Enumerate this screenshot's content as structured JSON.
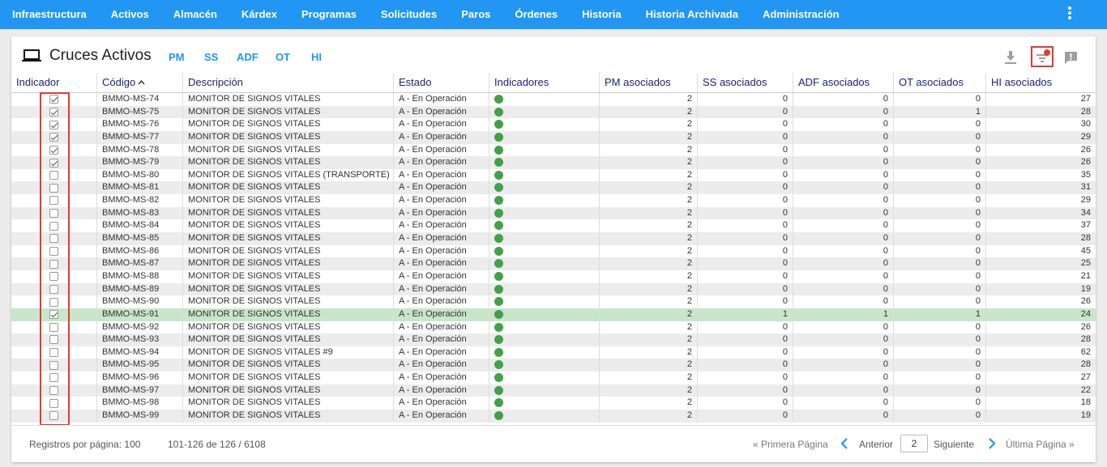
{
  "nav": {
    "items": [
      "Infraestructura",
      "Activos",
      "Almacén",
      "Kárdex",
      "Programas",
      "Solicitudes",
      "Paros",
      "Órdenes",
      "Historia",
      "Historia Archivada",
      "Administración"
    ],
    "menu_icon": "kebab-menu-icon"
  },
  "header": {
    "icon": "laptop-icon",
    "title": "Cruces Activos",
    "links": [
      "PM",
      "SS",
      "ADF",
      "OT",
      "HI"
    ],
    "tools": {
      "download": "download-icon",
      "filter": "filter-icon",
      "feedback": "feedback-icon"
    },
    "filter_active_color": "#e53935"
  },
  "table": {
    "columns": [
      "Indicador",
      "Código",
      "Descripción",
      "Estado",
      "Indicadores",
      "PM asociados",
      "SS asociados",
      "ADF asociados",
      "OT asociados",
      "HI asociados"
    ],
    "sort_indicator": "^",
    "sorted_column": "Código",
    "indicator_color": "#43a047",
    "highlight_color": "#c8e6c9",
    "rows": [
      {
        "checked": true,
        "code": "BMMO-MS-74",
        "desc": "MONITOR DE SIGNOS VITALES",
        "state": "A - En Operación",
        "pm": "2",
        "ss": "0",
        "adf": "0",
        "ot": "0",
        "hi": "27"
      },
      {
        "checked": true,
        "code": "BMMO-MS-75",
        "desc": "MONITOR DE SIGNOS VITALES",
        "state": "A - En Operación",
        "pm": "2",
        "ss": "0",
        "adf": "0",
        "ot": "1",
        "hi": "28"
      },
      {
        "checked": true,
        "code": "BMMO-MS-76",
        "desc": "MONITOR DE SIGNOS VITALES",
        "state": "A - En Operación",
        "pm": "2",
        "ss": "0",
        "adf": "0",
        "ot": "0",
        "hi": "30"
      },
      {
        "checked": true,
        "code": "BMMO-MS-77",
        "desc": "MONITOR DE SIGNOS VITALES",
        "state": "A - En Operación",
        "pm": "2",
        "ss": "0",
        "adf": "0",
        "ot": "0",
        "hi": "29"
      },
      {
        "checked": true,
        "code": "BMMO-MS-78",
        "desc": "MONITOR DE SIGNOS VITALES",
        "state": "A - En Operación",
        "pm": "2",
        "ss": "0",
        "adf": "0",
        "ot": "0",
        "hi": "26"
      },
      {
        "checked": true,
        "code": "BMMO-MS-79",
        "desc": "MONITOR DE SIGNOS VITALES",
        "state": "A - En Operación",
        "pm": "2",
        "ss": "0",
        "adf": "0",
        "ot": "0",
        "hi": "26"
      },
      {
        "checked": false,
        "code": "BMMO-MS-80",
        "desc": "MONITOR DE SIGNOS VITALES (TRANSPORTE)",
        "state": "A - En Operación",
        "pm": "2",
        "ss": "0",
        "adf": "0",
        "ot": "0",
        "hi": "35"
      },
      {
        "checked": false,
        "code": "BMMO-MS-81",
        "desc": "MONITOR DE SIGNOS VITALES",
        "state": "A - En Operación",
        "pm": "2",
        "ss": "0",
        "adf": "0",
        "ot": "0",
        "hi": "31"
      },
      {
        "checked": false,
        "code": "BMMO-MS-82",
        "desc": "MONITOR DE SIGNOS VITALES",
        "state": "A - En Operación",
        "pm": "2",
        "ss": "0",
        "adf": "0",
        "ot": "0",
        "hi": "29"
      },
      {
        "checked": false,
        "code": "BMMO-MS-83",
        "desc": "MONITOR DE SIGNOS VITALES",
        "state": "A - En Operación",
        "pm": "2",
        "ss": "0",
        "adf": "0",
        "ot": "0",
        "hi": "34"
      },
      {
        "checked": false,
        "code": "BMMO-MS-84",
        "desc": "MONITOR DE SIGNOS VITALES",
        "state": "A - En Operación",
        "pm": "2",
        "ss": "0",
        "adf": "0",
        "ot": "0",
        "hi": "37"
      },
      {
        "checked": false,
        "code": "BMMO-MS-85",
        "desc": "MONITOR DE SIGNOS VITALES",
        "state": "A - En Operación",
        "pm": "2",
        "ss": "0",
        "adf": "0",
        "ot": "0",
        "hi": "28"
      },
      {
        "checked": false,
        "code": "BMMO-MS-86",
        "desc": "MONITOR DE SIGNOS VITALES",
        "state": "A - En Operación",
        "pm": "2",
        "ss": "0",
        "adf": "0",
        "ot": "0",
        "hi": "45"
      },
      {
        "checked": false,
        "code": "BMMO-MS-87",
        "desc": "MONITOR DE SIGNOS VITALES",
        "state": "A - En Operación",
        "pm": "2",
        "ss": "0",
        "adf": "0",
        "ot": "0",
        "hi": "25"
      },
      {
        "checked": false,
        "code": "BMMO-MS-88",
        "desc": "MONITOR DE SIGNOS VITALES",
        "state": "A - En Operación",
        "pm": "2",
        "ss": "0",
        "adf": "0",
        "ot": "0",
        "hi": "21"
      },
      {
        "checked": false,
        "code": "BMMO-MS-89",
        "desc": "MONITOR DE SIGNOS VITALES",
        "state": "A - En Operación",
        "pm": "2",
        "ss": "0",
        "adf": "0",
        "ot": "0",
        "hi": "19"
      },
      {
        "checked": false,
        "code": "BMMO-MS-90",
        "desc": "MONITOR DE SIGNOS VITALES",
        "state": "A - En Operación",
        "pm": "2",
        "ss": "0",
        "adf": "0",
        "ot": "0",
        "hi": "26"
      },
      {
        "checked": true,
        "code": "BMMO-MS-91",
        "desc": "MONITOR DE SIGNOS VITALES",
        "state": "A - En Operación",
        "pm": "2",
        "ss": "1",
        "adf": "1",
        "ot": "1",
        "hi": "24",
        "highlight": true
      },
      {
        "checked": false,
        "code": "BMMO-MS-92",
        "desc": "MONITOR DE SIGNOS VITALES",
        "state": "A - En Operación",
        "pm": "2",
        "ss": "0",
        "adf": "0",
        "ot": "0",
        "hi": "26"
      },
      {
        "checked": false,
        "code": "BMMO-MS-93",
        "desc": "MONITOR DE SIGNOS VITALES",
        "state": "A - En Operación",
        "pm": "2",
        "ss": "0",
        "adf": "0",
        "ot": "0",
        "hi": "28"
      },
      {
        "checked": false,
        "code": "BMMO-MS-94",
        "desc": "MONITOR DE SIGNOS VITALES #9",
        "state": "A - En Operación",
        "pm": "2",
        "ss": "0",
        "adf": "0",
        "ot": "0",
        "hi": "62"
      },
      {
        "checked": false,
        "code": "BMMO-MS-95",
        "desc": "MONITOR DE SIGNOS VITALES",
        "state": "A - En Operación",
        "pm": "2",
        "ss": "0",
        "adf": "0",
        "ot": "0",
        "hi": "28"
      },
      {
        "checked": false,
        "code": "BMMO-MS-96",
        "desc": "MONITOR DE SIGNOS VITALES",
        "state": "A - En Operación",
        "pm": "2",
        "ss": "0",
        "adf": "0",
        "ot": "0",
        "hi": "27"
      },
      {
        "checked": false,
        "code": "BMMO-MS-97",
        "desc": "MONITOR DE SIGNOS VITALES",
        "state": "A - En Operación",
        "pm": "2",
        "ss": "0",
        "adf": "0",
        "ot": "0",
        "hi": "22"
      },
      {
        "checked": false,
        "code": "BMMO-MS-98",
        "desc": "MONITOR DE SIGNOS VITALES",
        "state": "A - En Operación",
        "pm": "2",
        "ss": "0",
        "adf": "0",
        "ot": "0",
        "hi": "18"
      },
      {
        "checked": false,
        "code": "BMMO-MS-99",
        "desc": "MONITOR DE SIGNOS VITALES",
        "state": "A - En Operación",
        "pm": "2",
        "ss": "0",
        "adf": "0",
        "ot": "0",
        "hi": "19"
      }
    ]
  },
  "footer": {
    "per_page": "Registros por página: 100",
    "range": "101-126 de 126 / 6108",
    "first": "« Primera Página",
    "prev": "Anterior",
    "page": "2",
    "next": "Siguiente",
    "last": "Última Página »",
    "accent": "#2196f3"
  }
}
